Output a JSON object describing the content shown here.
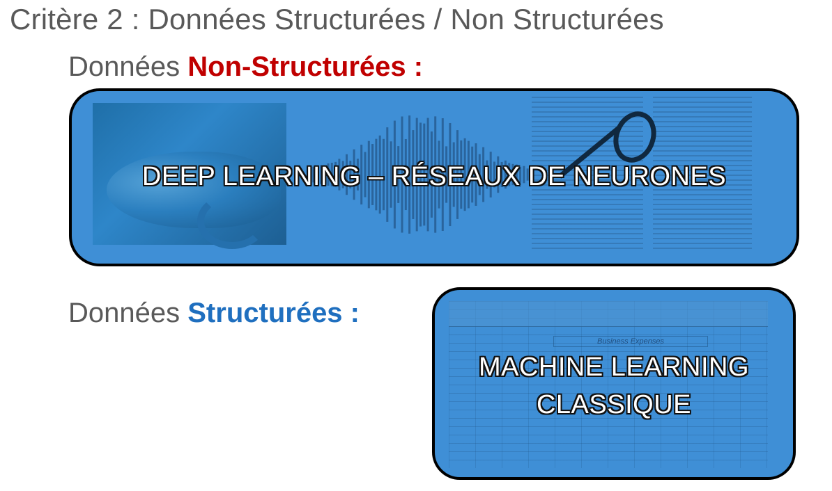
{
  "title": "Critère 2 : Données Structurées / Non Structurées",
  "unstructured": {
    "prefix": "Données",
    "emphasis": "Non-Structurées :",
    "emphasis_color": "#c00000",
    "panel_label": "DEEP LEARNING – RÉSEAUX DE NEURONES",
    "images": [
      "chameleon-photo",
      "audio-waveform",
      "text-document-with-glasses"
    ]
  },
  "structured": {
    "prefix": "Données",
    "emphasis": "Structurées :",
    "emphasis_color": "#1f6fbf",
    "panel_label_line1": "MACHINE LEARNING",
    "panel_label_line2": "CLASSIQUE",
    "spreadsheet_title": "Business Expenses"
  },
  "colors": {
    "panel_fill": "#3f8fd6",
    "text_gray": "#595959"
  }
}
